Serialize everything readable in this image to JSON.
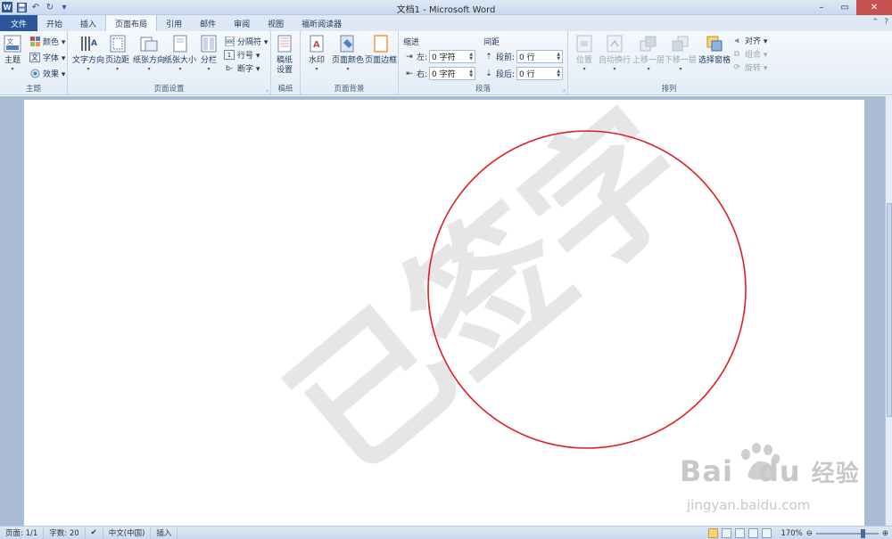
{
  "titlebar": {
    "title": "文档1 - Microsoft Word",
    "word_icon": "W",
    "qat": [
      "save-icon",
      "undo-icon",
      "redo-icon",
      "customize-icon"
    ]
  },
  "tabs": [
    "文件",
    "开始",
    "插入",
    "页面布局",
    "引用",
    "邮件",
    "审阅",
    "视图",
    "福昕阅读器"
  ],
  "active_tab": "页面布局",
  "ribbon": {
    "theme": {
      "label": "主题",
      "big": "主题",
      "colors": "颜色 ▾",
      "fonts": "字体 ▾",
      "effects": "效果 ▾"
    },
    "page_setup": {
      "label": "页面设置",
      "text_direction": "文字方向",
      "margins": "页边距",
      "orientation": "纸张方向",
      "size": "纸张大小",
      "columns": "分栏",
      "breaks": "分隔符 ▾",
      "line_numbers": "行号 ▾",
      "hyphenation": "断字 ▾"
    },
    "draft": {
      "label": "稿纸",
      "settings_line1": "稿纸",
      "settings_line2": "设置"
    },
    "background": {
      "label": "页面背景",
      "watermark": "水印",
      "page_color": "页面颜色",
      "page_borders": "页面边框"
    },
    "paragraph": {
      "label": "段落",
      "indent_title": "缩进",
      "spacing_title": "间距",
      "left_label": "左:",
      "left_value": "0 字符",
      "right_label": "右:",
      "right_value": "0 字符",
      "before_label": "段前:",
      "before_value": "0 行",
      "after_label": "段后:",
      "after_value": "0 行"
    },
    "arrange": {
      "label": "排列",
      "position": "位置",
      "wrap": "自动换行",
      "forward": "上移一层",
      "backward": "下移一层",
      "selection_pane": "选择窗格",
      "align": "对齐 ▾",
      "group": "组合 ▾",
      "rotate": "旋转 ▾"
    }
  },
  "document": {
    "watermark_glyph": "已签字",
    "circle_color": "#e02020"
  },
  "statusbar": {
    "page": "页面: 1/1",
    "words": "字数: 20",
    "language": "中文(中国)",
    "mode": "插入",
    "zoom": "170%"
  },
  "overlay": {
    "bai": "Bai",
    "du": "du",
    "jingyan": "经验",
    "url": "jingyan.baidu.com"
  }
}
